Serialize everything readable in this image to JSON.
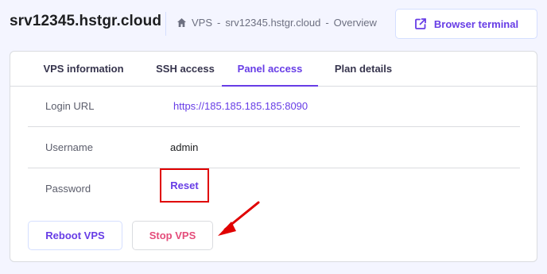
{
  "header": {
    "server_name": "srv12345.hstgr.cloud",
    "breadcrumb": [
      "VPS",
      "-",
      "srv12345.hstgr.cloud",
      "-",
      "Overview"
    ],
    "browser_terminal_label": "Browser terminal"
  },
  "tabs": [
    {
      "label": "VPS information",
      "active": false
    },
    {
      "label": "SSH access",
      "active": false
    },
    {
      "label": "Panel access",
      "active": true
    },
    {
      "label": "Plan details",
      "active": false
    }
  ],
  "panel_access": {
    "login_url": {
      "label": "Login URL",
      "value": "https://185.185.185.185:8090"
    },
    "username": {
      "label": "Username",
      "value": "admin"
    },
    "password": {
      "label": "Password",
      "action_label": "Reset"
    }
  },
  "actions": {
    "reboot_label": "Reboot VPS",
    "stop_label": "Stop VPS"
  },
  "colors": {
    "accent": "#673de6",
    "danger_text": "#e44c7a",
    "highlight_box": "#e00000",
    "page_bg": "#f4f5ff"
  },
  "icons": {
    "breadcrumb_home": "home-icon",
    "terminal": "external-link-icon",
    "annotation": "red-arrow-icon"
  }
}
